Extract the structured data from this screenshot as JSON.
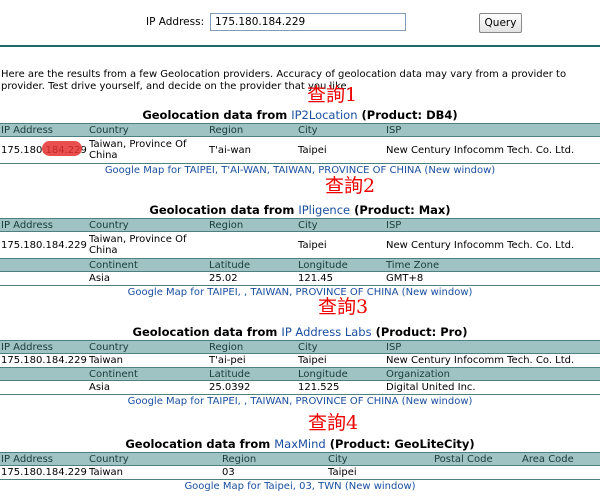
{
  "search": {
    "label": "IP Address:",
    "value": "175.180.184.229",
    "button": "Query"
  },
  "intro": "Here are the results from a few Geolocation providers. Accuracy of geolocation data may vary from a provider to provider. Test drive yourself, and decide on the provider that you like.",
  "notes": [
    "查詢1",
    "查詢2",
    "查詢3",
    "查詢4"
  ],
  "sections": [
    {
      "prefix": "Geolocation data from ",
      "provider": "IP2Location",
      "product": " (Product: DB4)",
      "headers": [
        "IP Address",
        "Country",
        "Region",
        "City",
        "ISP"
      ],
      "values": [
        "175.180.184.229",
        "Taiwan, Province Of China",
        "T'ai-wan",
        "Taipei",
        "New Century Infocomm Tech. Co. Ltd."
      ],
      "map": "Google Map for TAIPEI, T'AI-WAN, TAIWAN, PROVINCE OF CHINA (New window)"
    },
    {
      "prefix": "Geolocation data from ",
      "provider": "IPligence",
      "product": " (Product: Max)",
      "headers": [
        "IP Address",
        "Country",
        "Region",
        "City",
        "ISP"
      ],
      "values": [
        "175.180.184.229",
        "Taiwan, Province Of China",
        "",
        "Taipei",
        "New Century Infocomm Tech. Co. Ltd."
      ],
      "headers2": [
        "",
        "Continent",
        "Latitude",
        "Longitude",
        "Time Zone"
      ],
      "values2": [
        "",
        "Asia",
        "25.02",
        "121.45",
        "GMT+8"
      ],
      "map": "Google Map for TAIPEI, , TAIWAN, PROVINCE OF CHINA (New window)"
    },
    {
      "prefix": "Geolocation data from ",
      "provider": "IP Address Labs",
      "product": " (Product: Pro)",
      "headers": [
        "IP Address",
        "Country",
        "Region",
        "City",
        "ISP"
      ],
      "values": [
        "175.180.184.229",
        "Taiwan",
        "T'ai-pei",
        "Taipei",
        "New Century Infocomm Tech. Co. Ltd."
      ],
      "headers2": [
        "",
        "Continent",
        "Latitude",
        "Longitude",
        "Organization"
      ],
      "values2": [
        "",
        "Asia",
        "25.0392",
        "121.525",
        "Digital United Inc."
      ],
      "map": "Google Map for TAIPEI, , TAIWAN, PROVINCE OF CHINA (New window)"
    },
    {
      "prefix": "Geolocation data from ",
      "provider": "MaxMind",
      "product": " (Product: GeoLiteCity)",
      "headers": [
        "IP Address",
        "Country",
        "Region",
        "City",
        "Postal Code",
        "Area Code"
      ],
      "values": [
        "175.180.184.229",
        "Taiwan",
        "03",
        "Taipei",
        "",
        ""
      ],
      "map": "Google Map for Taipei, 03, TWN (New window)"
    }
  ]
}
